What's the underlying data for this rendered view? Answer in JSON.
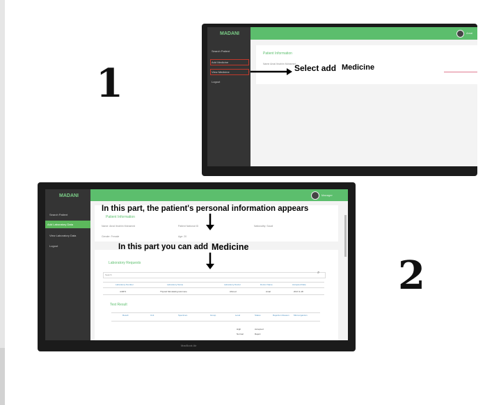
{
  "step1": {
    "number": "1",
    "app": {
      "logo": "MADANI",
      "sidebar": [
        "Search Patient",
        "Add Medicine",
        "View Medicine",
        "Logout"
      ],
      "section_title": "Patient Information",
      "field_line": "Name  Amal Ibrahim Mohamed",
      "avatar_text": "Amal"
    },
    "annotation": "Select add",
    "annotation_word": "Medicine"
  },
  "step2": {
    "number": "2",
    "app": {
      "logo": "MADANI",
      "sidebar": [
        "Search Patient",
        "Add Laboratory Data",
        "View Laboratory Data",
        "Logout"
      ],
      "section_title": "Patient Information",
      "info_fields": [
        "Name: Amal Ibrahim Mohamed",
        "Patient National ID",
        "Nationality: Saudi",
        "Gender: Female",
        "Age: 20"
      ],
      "requests_title": "Laboratory Requests",
      "search_placeholder": "Search",
      "table_headers": [
        "Laboratory Number",
        "Laboratory Name",
        "Laboratory Doctor",
        "Doctor Name",
        "Accepted Date"
      ],
      "table_row": [
        "4-6871",
        "Thyroid Stimulating Hormone",
        "Ahmed",
        "Amal",
        "2017-4-18"
      ],
      "result_title": "Test Result",
      "result_headers": [
        "Result",
        "Unit",
        "Specimen",
        "Group",
        "Level",
        "Status",
        "Rejection Reason",
        "Microorganism"
      ],
      "result_options": [
        "High",
        "Accepted",
        "Normal",
        "Reject"
      ],
      "avatar_text": "Manager",
      "base_label": "MacBook Air"
    },
    "caption_top": "In this part, the patient's personal information appears",
    "caption_mid": "In this part you can add",
    "caption_mid_word": "Medicine"
  }
}
